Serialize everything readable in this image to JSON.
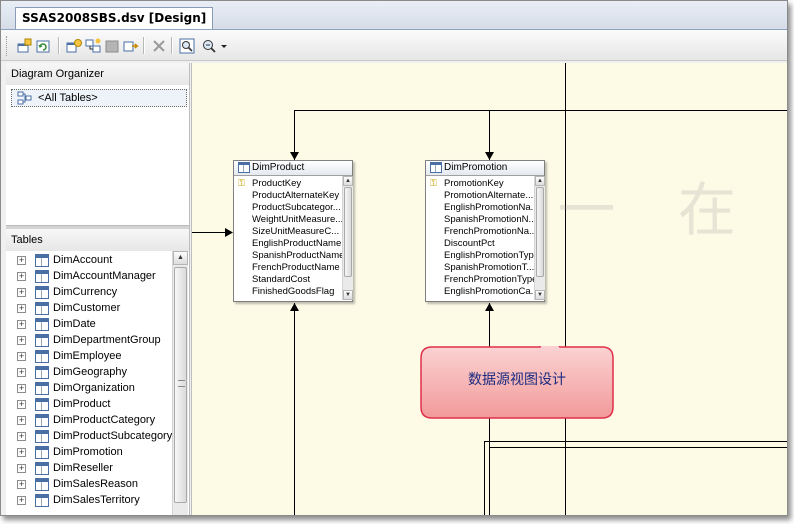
{
  "document_tab": {
    "title": "SSAS2008SBS.dsv [Design]"
  },
  "toolbar": {
    "icons": [
      "add-remove-tables-icon",
      "refresh-icon",
      "new-named-query-icon",
      "new-relationship-icon",
      "replace-table-icon",
      "find-table-icon",
      "delete-icon",
      "zoom-to-fit-icon",
      "zoom-icon",
      "dropdown-arrow-icon"
    ]
  },
  "diagram_organizer": {
    "header": "Diagram Organizer",
    "items": [
      {
        "label": "<All Tables>"
      }
    ]
  },
  "tables_pane": {
    "header": "Tables",
    "items": [
      "DimAccount",
      "DimAccountManager",
      "DimCurrency",
      "DimCustomer",
      "DimDate",
      "DimDepartmentGroup",
      "DimEmployee",
      "DimGeography",
      "DimOrganization",
      "DimProduct",
      "DimProductCategory",
      "DimProductSubcategory",
      "DimPromotion",
      "DimReseller",
      "DimSalesReason",
      "DimSalesTerritory"
    ]
  },
  "diagram": {
    "tables": [
      {
        "title": "DimProduct",
        "columns": [
          "ProductKey",
          "ProductAlternateKey",
          "ProductSubcategor...",
          "WeightUnitMeasure...",
          "SizeUnitMeasureC...",
          "EnglishProductName",
          "SpanishProductName",
          "FrenchProductName",
          "StandardCost",
          "FinishedGoodsFlag"
        ]
      },
      {
        "title": "DimPromotion",
        "columns": [
          "PromotionKey",
          "PromotionAlternate...",
          "EnglishPromotionNa...",
          "SpanishPromotionN...",
          "FrenchPromotionNa...",
          "DiscountPct",
          "EnglishPromotionType",
          "SpanishPromotionT...",
          "FrenchPromotionType",
          "EnglishPromotionCa..."
        ]
      }
    ],
    "watermark": "天 一 在 线",
    "callout_text": "数据源视图设计",
    "colors": {
      "canvas": "#fdfae6",
      "callout_fill": "#f4a0a0",
      "callout_border": "#e0304a",
      "callout_text": "#1a2a80"
    }
  }
}
